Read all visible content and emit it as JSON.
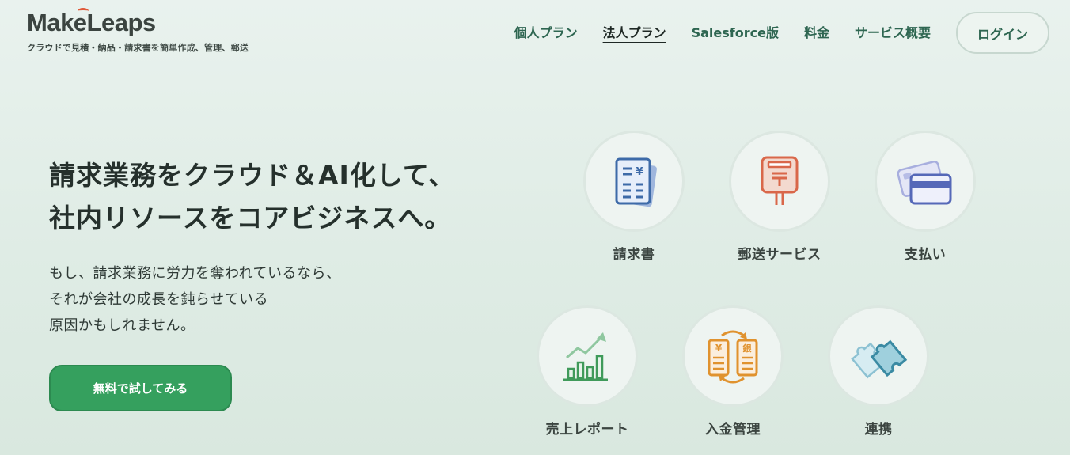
{
  "header": {
    "logo": "MakeLeaps",
    "tagline": "クラウドで見積・納品・請求書を簡単作成、管理、郵送",
    "nav": [
      {
        "label": "個人プラン"
      },
      {
        "label": "法人プラン"
      },
      {
        "label": "Salesforce版"
      },
      {
        "label": "料金"
      },
      {
        "label": "サービス概要"
      }
    ],
    "login_label": "ログイン"
  },
  "hero": {
    "headline_line1": "請求業務をクラウド＆AI化して、",
    "headline_line2": "社内リソースをコアビジネスへ。",
    "sub_line1": "もし、請求業務に労力を奪われているなら、",
    "sub_line2": "それが会社の成長を鈍らせている",
    "sub_line3": "原因かもしれません。",
    "cta_label": "無料で試してみる"
  },
  "features": [
    {
      "label": "請求書",
      "icon": "invoice-icon"
    },
    {
      "label": "郵送サービス",
      "icon": "postbox-icon"
    },
    {
      "label": "支払い",
      "icon": "credit-card-icon"
    },
    {
      "label": "売上レポート",
      "icon": "chart-icon"
    },
    {
      "label": "入金管理",
      "icon": "payment-exchange-icon"
    },
    {
      "label": "連携",
      "icon": "puzzle-icon"
    }
  ],
  "icon_glyphs": {
    "yen": "¥",
    "bank": "銀"
  },
  "colors": {
    "accent_green": "#35a05e",
    "nav_green": "#2e6651",
    "invoice_blue": "#3d6aa8",
    "postbox_red": "#d9674a",
    "card_blue": "#5568b8",
    "chart_green": "#3f9a5a",
    "exchange_orange": "#e0922e",
    "puzzle_teal": "#3a8aa3"
  }
}
